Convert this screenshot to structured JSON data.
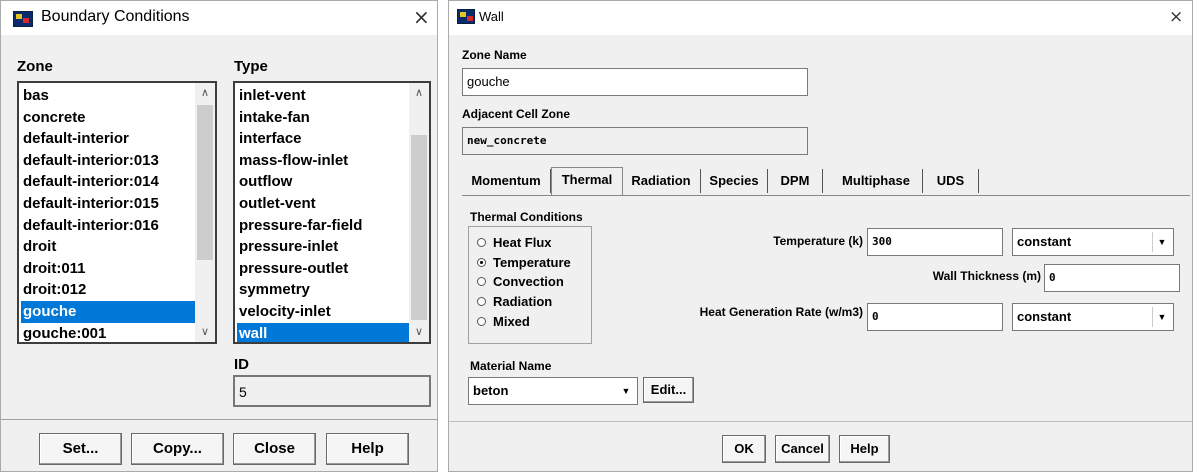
{
  "boundary_dialog": {
    "title": "Boundary Conditions",
    "close_glyph": "×",
    "zone_label": "Zone",
    "type_label": "Type",
    "zones": [
      "bas",
      "concrete",
      "default-interior",
      "default-interior:013",
      "default-interior:014",
      "default-interior:015",
      "default-interior:016",
      "droit",
      "droit:011",
      "droit:012",
      "gouche",
      "gouche:001"
    ],
    "selected_zone": "gouche",
    "types": [
      "inlet-vent",
      "intake-fan",
      "interface",
      "mass-flow-inlet",
      "outflow",
      "outlet-vent",
      "pressure-far-field",
      "pressure-inlet",
      "pressure-outlet",
      "symmetry",
      "velocity-inlet",
      "wall"
    ],
    "selected_type": "wall",
    "id_label": "ID",
    "id_value": "5",
    "buttons": {
      "set": "Set...",
      "copy": "Copy...",
      "close": "Close",
      "help": "Help"
    }
  },
  "wall_dialog": {
    "title": "Wall",
    "close_glyph": "×",
    "zone_name_label": "Zone Name",
    "zone_name_value": "gouche",
    "adjacent_label": "Adjacent Cell Zone",
    "adjacent_value": "new_concrete",
    "tabs": [
      "Momentum",
      "Thermal",
      "Radiation",
      "Species",
      "DPM",
      "Multiphase",
      "UDS"
    ],
    "active_tab": "Thermal",
    "thermal": {
      "conditions_label": "Thermal Conditions",
      "options": [
        "Heat Flux",
        "Temperature",
        "Convection",
        "Radiation",
        "Mixed"
      ],
      "selected_option": "Temperature",
      "temperature_label": "Temperature (k)",
      "temperature_value": "300",
      "temperature_mode": "constant",
      "wall_thickness_label": "Wall Thickness (m)",
      "wall_thickness_value": "0",
      "heat_gen_label": "Heat Generation Rate (w/m3)",
      "heat_gen_value": "0",
      "heat_gen_mode": "constant"
    },
    "material_label": "Material Name",
    "material_value": "beton",
    "edit_label": "Edit...",
    "buttons": {
      "ok": "OK",
      "cancel": "Cancel",
      "help": "Help"
    }
  },
  "icons": {
    "app": "fluent-app-icon",
    "dropdown": "▼",
    "scroll_up": "∧",
    "scroll_down": "∨"
  }
}
